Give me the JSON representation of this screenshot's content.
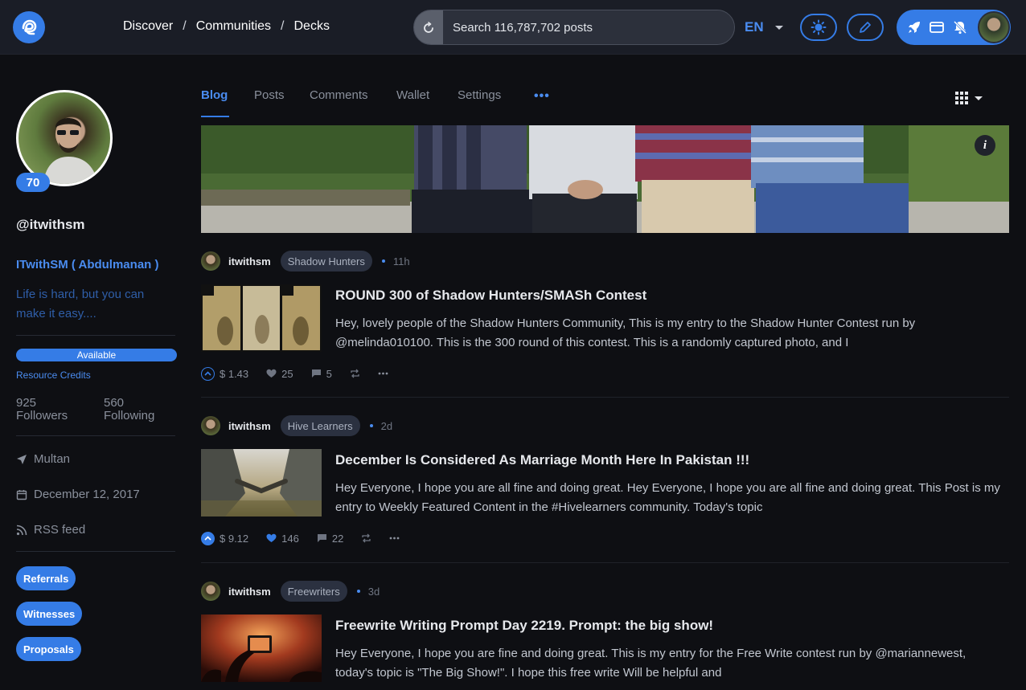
{
  "topbar": {
    "breadcrumb": [
      "Discover",
      "Communities",
      "Decks"
    ],
    "breadcrumb_sep": "/",
    "search_placeholder": "Search 116,787,702 posts",
    "language": "EN"
  },
  "colors": {
    "accent": "#357ce6",
    "background": "#0e0f13",
    "topbar": "#1a1d26"
  },
  "profile": {
    "reputation": "70",
    "username": "@itwithsm",
    "display_name": "ITwithSM ( Abdulmanan )",
    "about": "Life is hard, but you can make it easy....",
    "rc_status": "Available",
    "rc_label": "Resource Credits",
    "followers_count": "925",
    "followers_label": "Followers",
    "following_count": "560",
    "following_label": "Following",
    "location": "Multan",
    "joined": "December 12, 2017",
    "rss": "RSS feed",
    "buttons": [
      "Referrals",
      "Witnesses",
      "Proposals"
    ]
  },
  "tabs": {
    "items": [
      "Blog",
      "Posts",
      "Comments",
      "Wallet",
      "Settings"
    ],
    "active": "Blog",
    "more": "•••"
  },
  "posts": [
    {
      "author": "itwithsm",
      "community": "Shadow Hunters",
      "age": "11h",
      "title": "ROUND 300 of Shadow Hunters/SMASh Contest",
      "excerpt": "Hey, lovely people of the Shadow Hunters Community, This is my entry to the Shadow Hunter Contest run by @melinda010100. This is the 300 round of this contest. This is a randomly captured photo, and I",
      "payout": "$ 1.43",
      "votes": "25",
      "comments": "5",
      "voted": false
    },
    {
      "author": "itwithsm",
      "community": "Hive Learners",
      "age": "2d",
      "title": "December Is Considered As Marriage Month Here In Pakistan !!!",
      "excerpt": "Hey Everyone, I hope you are all fine and doing great. Hey Everyone, I hope you are all fine and doing great. This Post is my entry to Weekly Featured Content in the #Hivelearners community. Today's topic",
      "payout": "$ 9.12",
      "votes": "146",
      "comments": "22",
      "voted": true
    },
    {
      "author": "itwithsm",
      "community": "Freewriters",
      "age": "3d",
      "title": "Freewrite Writing Prompt Day 2219. Prompt: the big show!",
      "excerpt": "Hey Everyone, I hope you are fine and doing great. This is my entry for the Free Write contest run by @mariannewest, today's topic is \"The Big Show!\". I hope this free write Will be helpful and"
    }
  ]
}
